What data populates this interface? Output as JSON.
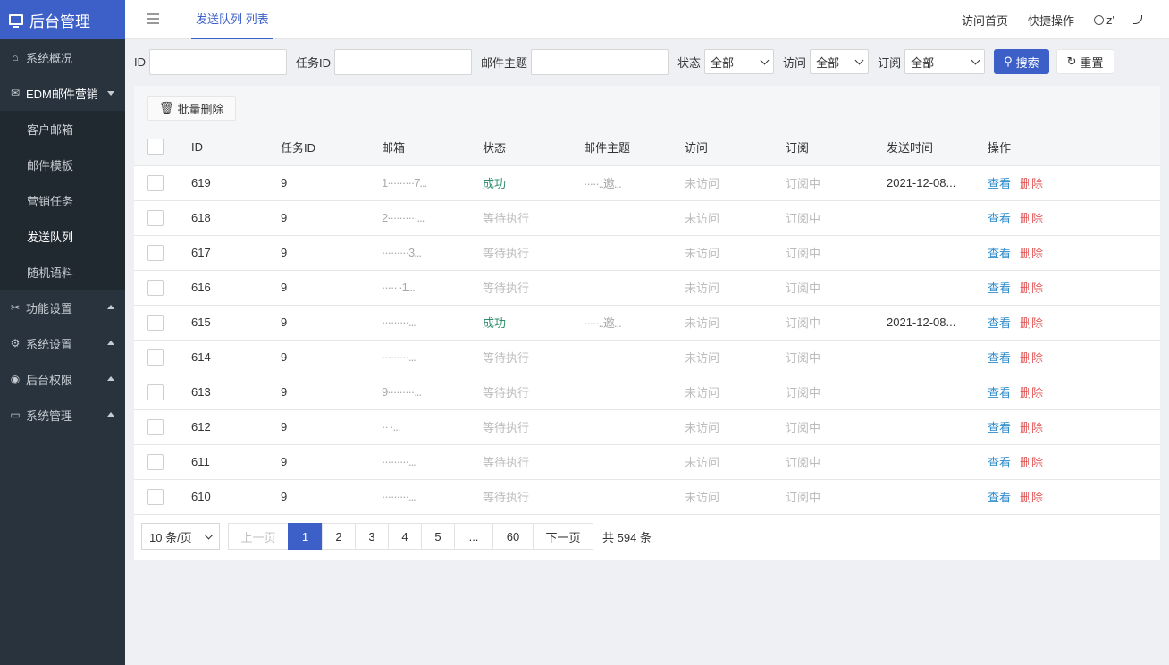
{
  "app": {
    "title": "后台管理"
  },
  "sidebar": {
    "items": [
      {
        "label": "系统概况",
        "icon": "home-icon"
      },
      {
        "label": "EDM邮件营销",
        "icon": "mail-icon"
      },
      {
        "label": "功能设置",
        "icon": "tools-icon"
      },
      {
        "label": "系统设置",
        "icon": "gear-icon"
      },
      {
        "label": "后台权限",
        "icon": "user-circle-icon"
      },
      {
        "label": "系统管理",
        "icon": "dashboard-icon"
      }
    ],
    "submenu": [
      "客户邮箱",
      "邮件模板",
      "营销任务",
      "发送队列",
      "随机语料"
    ]
  },
  "topbar": {
    "tab": "发送队列 列表",
    "links": [
      "访问首页",
      "快捷操作"
    ],
    "user": "z'"
  },
  "filter": {
    "id_label": "ID",
    "task_label": "任务ID",
    "subject_label": "邮件主题",
    "status_label": "状态",
    "status_value": "全部",
    "visit_label": "访问",
    "visit_value": "全部",
    "sub_label": "订阅",
    "sub_value": "全部",
    "search_label": "搜索",
    "reset_label": "重置"
  },
  "toolbar": {
    "batch_delete": "批量删除"
  },
  "table": {
    "headers": [
      "ID",
      "任务ID",
      "邮箱",
      "状态",
      "邮件主题",
      "访问",
      "订阅",
      "发送时间",
      "操作"
    ],
    "view_label": "查看",
    "delete_label": "删除",
    "rows": [
      {
        "id": "619",
        "task": "9",
        "email": "1·········7...",
        "status": "成功",
        "subject": "·····..邀...",
        "visit": "未访问",
        "sub": "订阅中",
        "time": "2021-12-08..."
      },
      {
        "id": "618",
        "task": "9",
        "email": "2··········...",
        "status": "等待执行",
        "subject": "",
        "visit": "未访问",
        "sub": "订阅中",
        "time": ""
      },
      {
        "id": "617",
        "task": "9",
        "email": "·········3...",
        "status": "等待执行",
        "subject": "",
        "visit": "未访问",
        "sub": "订阅中",
        "time": ""
      },
      {
        "id": "616",
        "task": "9",
        "email": "·····  ·1...",
        "status": "等待执行",
        "subject": "",
        "visit": "未访问",
        "sub": "订阅中",
        "time": ""
      },
      {
        "id": "615",
        "task": "9",
        "email": "·········...",
        "status": "成功",
        "subject": "·····..邀...",
        "visit": "未访问",
        "sub": "订阅中",
        "time": "2021-12-08..."
      },
      {
        "id": "614",
        "task": "9",
        "email": "·········...",
        "status": "等待执行",
        "subject": "",
        "visit": "未访问",
        "sub": "订阅中",
        "time": ""
      },
      {
        "id": "613",
        "task": "9",
        "email": "9·········...",
        "status": "等待执行",
        "subject": "",
        "visit": "未访问",
        "sub": "订阅中",
        "time": ""
      },
      {
        "id": "612",
        "task": "9",
        "email": "··      ·...",
        "status": "等待执行",
        "subject": "",
        "visit": "未访问",
        "sub": "订阅中",
        "time": ""
      },
      {
        "id": "611",
        "task": "9",
        "email": "·········...",
        "status": "等待执行",
        "subject": "",
        "visit": "未访问",
        "sub": "订阅中",
        "time": ""
      },
      {
        "id": "610",
        "task": "9",
        "email": "·········...",
        "status": "等待执行",
        "subject": "",
        "visit": "未访问",
        "sub": "订阅中",
        "time": ""
      }
    ]
  },
  "pager": {
    "page_size": "10 条/页",
    "prev": "上一页",
    "pages": [
      "1",
      "2",
      "3",
      "4",
      "5",
      "...",
      "60"
    ],
    "current": "1",
    "next": "下一页",
    "total": "共 594 条"
  }
}
